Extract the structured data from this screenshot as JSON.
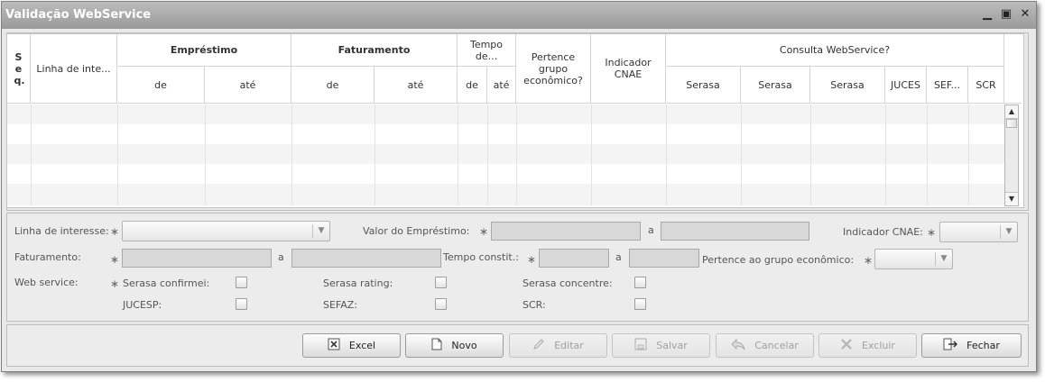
{
  "window": {
    "title": "Validação WebService"
  },
  "grid": {
    "headers": {
      "seq": "S e q.",
      "linha": "Linha de inte...",
      "emprestimo": "Empréstimo",
      "faturamento": "Faturamento",
      "tempo": "Tempo de...",
      "pertence": "Pertence grupo econômico?",
      "indicador": "Indicador CNAE",
      "consulta": "Consulta WebService?",
      "de": "de",
      "ate": "até",
      "serasa": "Serasa",
      "juces": "JUCES",
      "sef": "SEF...",
      "scr": "SCR"
    }
  },
  "form": {
    "linha_label": "Linha de interesse:",
    "valor_label": "Valor do Empréstimo:",
    "a": "a",
    "indicador_label": "Indicador CNAE:",
    "faturamento_label": "Faturamento:",
    "tempo_label": "Tempo constit.:",
    "pertence_label": "Pertence ao grupo econômico:",
    "webservice_label": "Web service:",
    "serasa_confirmei": "Serasa confirmei:",
    "serasa_rating": "Serasa rating:",
    "serasa_concentre": "Serasa concentre:",
    "jucesp": "JUCESP:",
    "sefaz": "SEFAZ:",
    "scr": "SCR:",
    "required_mark": "∗"
  },
  "buttons": {
    "excel": "Excel",
    "novo": "Novo",
    "editar": "Editar",
    "salvar": "Salvar",
    "cancelar": "Cancelar",
    "excluir": "Excluir",
    "fechar": "Fechar"
  }
}
